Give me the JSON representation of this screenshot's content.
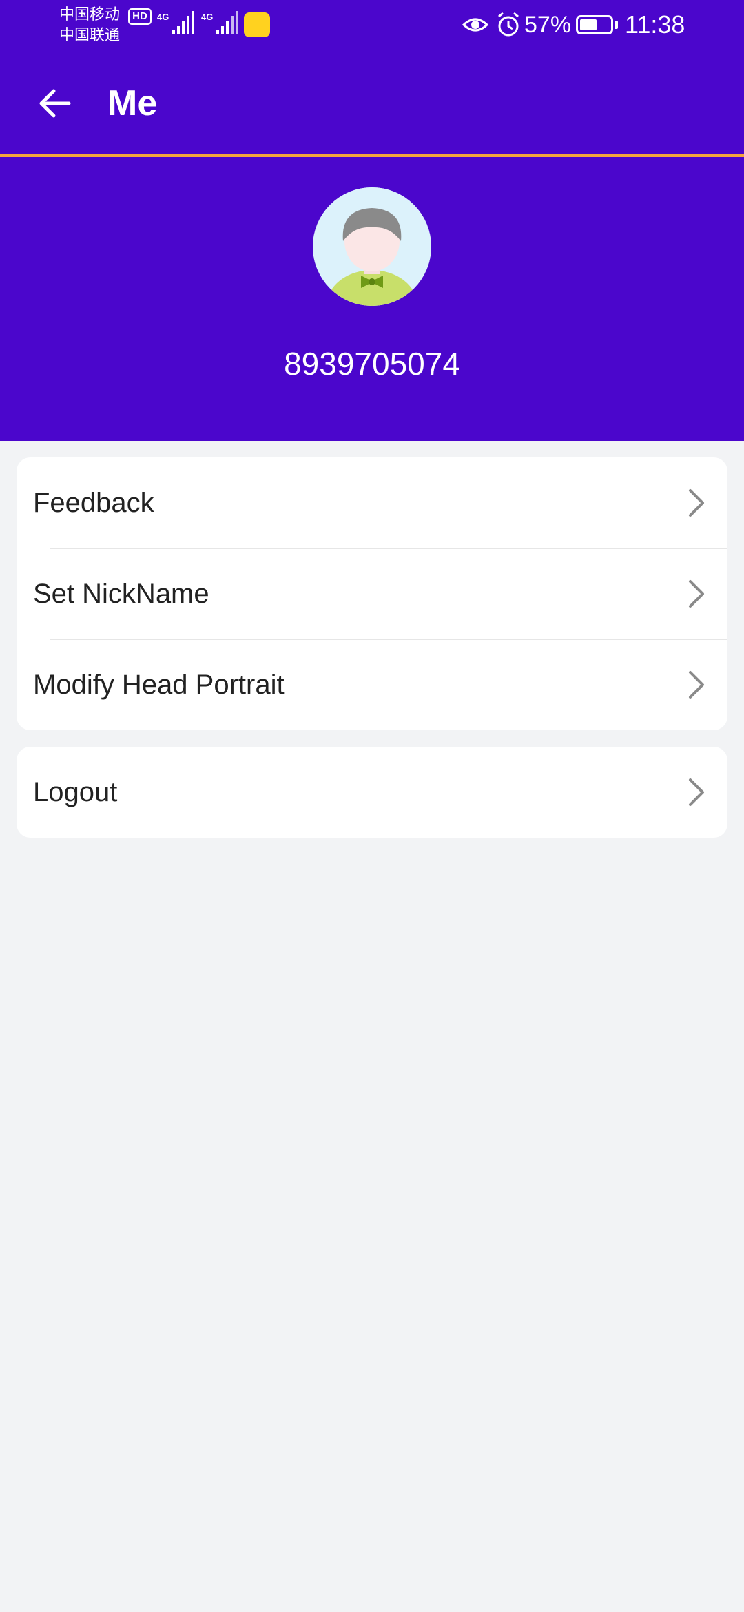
{
  "status_bar": {
    "carrier_1": "中国移动",
    "carrier_2": "中国联通",
    "hd_label": "HD",
    "network_1": "4G",
    "network_2": "4G",
    "battery_percent": "57%",
    "battery_level": 0.57,
    "time": "11:38",
    "icons": [
      "signal-icon",
      "eye-icon",
      "alarm-icon",
      "battery-icon"
    ]
  },
  "app_bar": {
    "title": "Me",
    "back_icon": "arrow-left-icon"
  },
  "profile": {
    "user_id": "8939705074",
    "avatar_icon": "default-avatar-icon"
  },
  "menu": {
    "items": [
      {
        "label": "Feedback"
      },
      {
        "label": "Set NickName"
      },
      {
        "label": "Modify Head Portrait"
      }
    ]
  },
  "logout": {
    "label": "Logout"
  },
  "colors": {
    "primary": "#4b06cc",
    "accent_line": "#f5a63d",
    "background": "#f2f3f5",
    "card": "#ffffff",
    "text": "#222222",
    "chevron": "#8a8a8a"
  }
}
